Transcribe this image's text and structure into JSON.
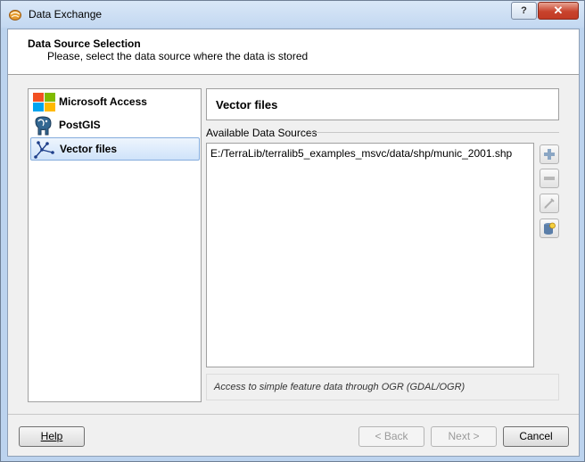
{
  "window": {
    "title": "Data Exchange",
    "help_glyph": "?",
    "close_glyph": "✕"
  },
  "header": {
    "title": "Data Source Selection",
    "subtitle": "Please, select the data source where the data is stored"
  },
  "data_sources": {
    "items": [
      {
        "label": "Microsoft Access",
        "icon": "microsoft-access-icon",
        "selected": false
      },
      {
        "label": "PostGIS",
        "icon": "postgis-elephant-icon",
        "selected": false
      },
      {
        "label": "Vector files",
        "icon": "vector-files-icon",
        "selected": true
      }
    ]
  },
  "detail": {
    "title": "Vector files",
    "available_label": "Available Data Sources",
    "sources": [
      "E:/TerraLib/terralib5_examples_msvc/data/shp/munic_2001.shp"
    ],
    "description": "Access to simple feature data through OGR (GDAL/OGR)",
    "side_buttons": [
      "add-icon",
      "remove-icon",
      "edit-icon",
      "explore-datasource-icon"
    ]
  },
  "footer": {
    "help": "Help",
    "back": "< Back",
    "next": "Next >",
    "cancel": "Cancel"
  },
  "colors": {
    "title_bar": "#c3d8f1",
    "selection": "#cfe3fa",
    "close_button": "#c8432d"
  }
}
